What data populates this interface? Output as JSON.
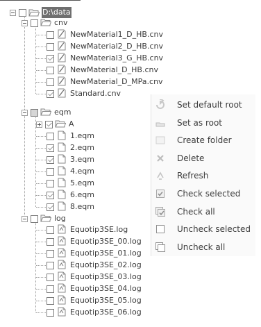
{
  "root": {
    "label": "D:\\data"
  },
  "tree": [
    {
      "kind": "folder",
      "id": "cnv",
      "label": "cnv",
      "checked": false,
      "expanded": true,
      "children": [
        {
          "label": "NewMaterial1_D_HB.cnv",
          "checked": false,
          "icon": "curve-file-icon"
        },
        {
          "label": "NewMaterial2_D_HB.cnv",
          "checked": false,
          "icon": "curve-file-icon"
        },
        {
          "label": "NewMaterial3_G_HB.cnv",
          "checked": true,
          "icon": "curve-file-icon"
        },
        {
          "label": "NewMaterial_D_HB.cnv",
          "checked": false,
          "icon": "curve-file-icon"
        },
        {
          "label": "NewMaterial_D_MPa.cnv",
          "checked": false,
          "icon": "curve-file-icon"
        },
        {
          "label": "Standard.cnv",
          "checked": true,
          "icon": "curve-file-icon"
        }
      ]
    },
    {
      "kind": "folder",
      "id": "eqm",
      "label": "eqm",
      "checked": "partial",
      "expanded": true,
      "children": [
        {
          "label": "A",
          "checked": true,
          "icon": "folder-icon",
          "collapsed": true
        },
        {
          "label": "1.eqm",
          "checked": false,
          "icon": "document-icon"
        },
        {
          "label": "2.eqm",
          "checked": true,
          "icon": "document-icon"
        },
        {
          "label": "3.eqm",
          "checked": true,
          "icon": "document-icon"
        },
        {
          "label": "4.eqm",
          "checked": false,
          "icon": "document-icon"
        },
        {
          "label": "5.eqm",
          "checked": false,
          "icon": "document-icon"
        },
        {
          "label": "6.eqm",
          "checked": true,
          "icon": "document-icon"
        },
        {
          "label": "8.eqm",
          "checked": true,
          "icon": "document-icon"
        }
      ]
    },
    {
      "kind": "folder",
      "id": "log",
      "label": "log",
      "checked": false,
      "expanded": true,
      "children": [
        {
          "label": "Equotip3SE.log",
          "checked": false,
          "icon": "log-file-icon"
        },
        {
          "label": "Equotip3SE_00.log",
          "checked": false,
          "icon": "log-file-icon"
        },
        {
          "label": "Equotip3SE_01.log",
          "checked": false,
          "icon": "log-file-icon"
        },
        {
          "label": "Equotip3SE_02.log",
          "checked": false,
          "icon": "log-file-icon"
        },
        {
          "label": "Equotip3SE_03.log",
          "checked": false,
          "icon": "log-file-icon"
        },
        {
          "label": "Equotip3SE_04.log",
          "checked": false,
          "icon": "log-file-icon"
        },
        {
          "label": "Equotip3SE_05.log",
          "checked": false,
          "icon": "log-file-icon"
        },
        {
          "label": "Equotip3SE_06.log",
          "checked": false,
          "icon": "log-file-icon"
        }
      ]
    }
  ],
  "context_menu": {
    "items": [
      {
        "label": "Set default root",
        "icon": "set-default-root-icon"
      },
      {
        "label": "Set as root",
        "icon": "set-as-root-icon"
      },
      {
        "label": "Create folder",
        "icon": "create-folder-icon"
      },
      {
        "label": "Delete",
        "icon": "delete-icon"
      },
      {
        "label": "Refresh",
        "icon": "refresh-icon"
      },
      {
        "label": "Check selected",
        "icon": "check-selected-icon"
      },
      {
        "label": "Check all",
        "icon": "check-all-icon"
      },
      {
        "label": "Uncheck selected",
        "icon": "uncheck-selected-icon"
      },
      {
        "label": "Uncheck all",
        "icon": "uncheck-all-icon"
      }
    ]
  }
}
